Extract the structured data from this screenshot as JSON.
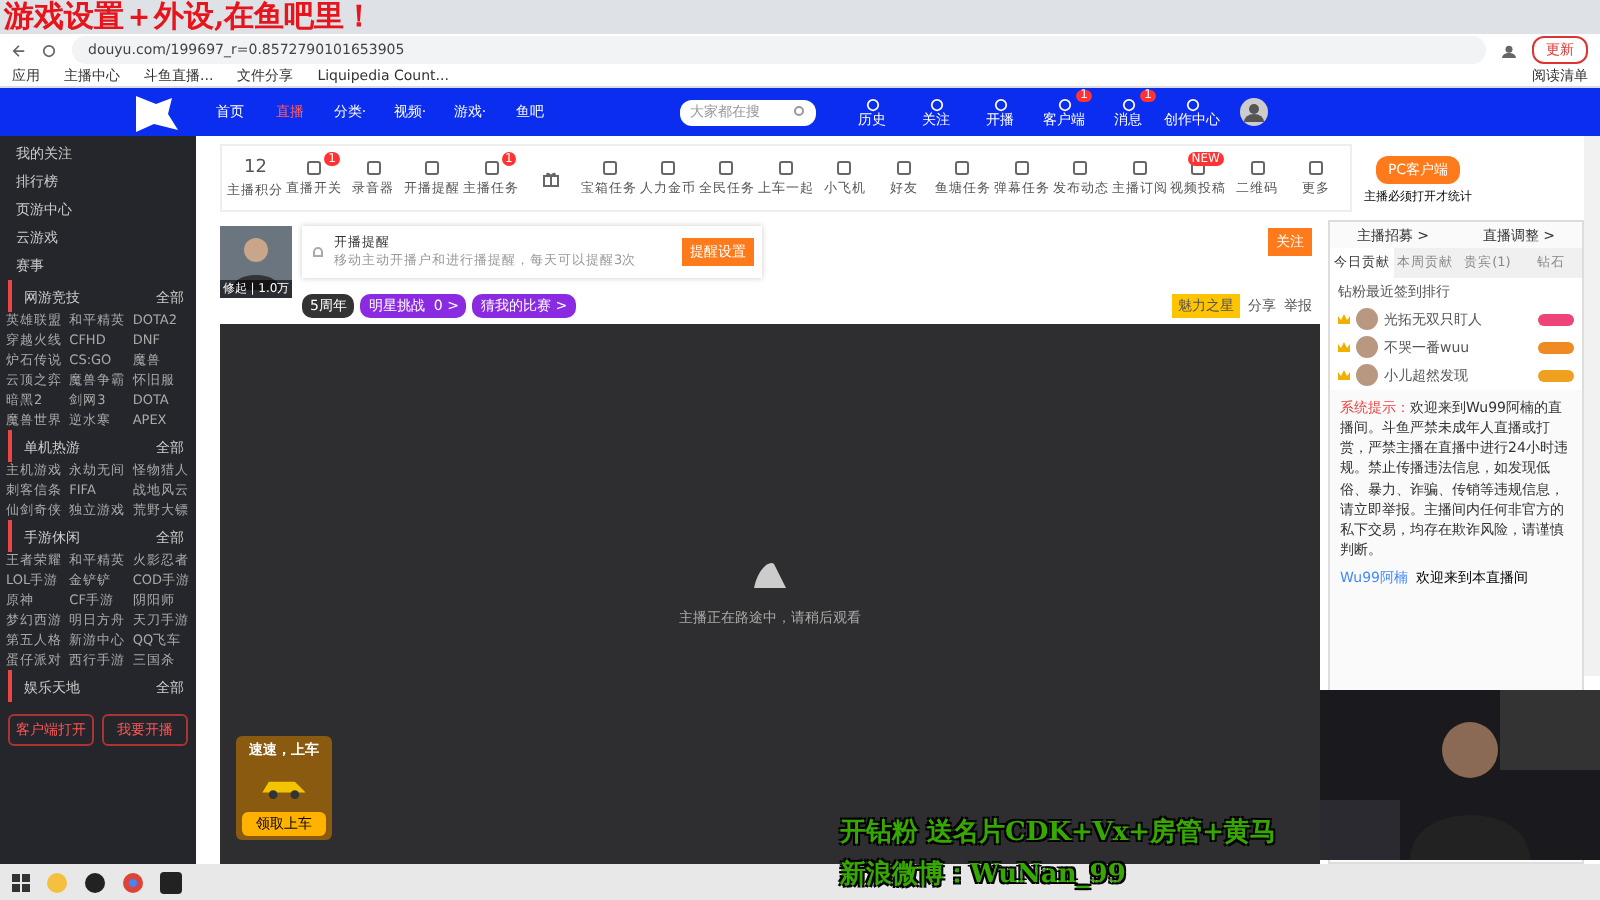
{
  "overlay_title": "游戏设置＋外设,在鱼吧里！",
  "browser": {
    "url": "douyu.com/199697_r=0.8572790101653905",
    "bookmarks": [
      "应用",
      "主播中心",
      "斗鱼直播...",
      "文件分享",
      "Liquipedia Count..."
    ],
    "reading_list": "阅读清单",
    "profile_button": "更新"
  },
  "header": {
    "nav": [
      {
        "label": "首页",
        "selected": false
      },
      {
        "label": "直播",
        "selected": true
      },
      {
        "label": "分类·",
        "selected": false
      },
      {
        "label": "视频·",
        "selected": false
      },
      {
        "label": "游戏·",
        "selected": false
      },
      {
        "label": "鱼吧",
        "selected": false
      }
    ],
    "search": {
      "placeholder": "大家都在搜"
    },
    "actions": [
      {
        "label": "历史"
      },
      {
        "label": "关注"
      },
      {
        "label": "开播"
      },
      {
        "label": "客户端",
        "badge": "1"
      },
      {
        "label": "消息",
        "badge": "1"
      },
      {
        "label": "创作中心"
      }
    ]
  },
  "sidebar": {
    "links": [
      "我的关注",
      "排行榜",
      "页游中心",
      "云游戏",
      "赛事"
    ],
    "sections": [
      {
        "title": "网游竞技",
        "more": "全部",
        "games": [
          "英雄联盟",
          "和平精英",
          "DOTA2",
          "穿越火线",
          "CFHD",
          "DNF",
          "炉石传说",
          "CS:GO",
          "魔兽",
          "云顶之弈",
          "魔兽争霸",
          "怀旧服",
          "暗黑2",
          "剑网3",
          "DOTA",
          "魔兽世界",
          "逆水寒",
          "APEX"
        ]
      },
      {
        "title": "单机热游",
        "more": "全部",
        "games": [
          "主机游戏",
          "永劫无间",
          "怪物猎人",
          "刺客信条",
          "FIFA",
          "战地风云",
          "仙剑奇侠",
          "独立游戏",
          "荒野大镖"
        ]
      },
      {
        "title": "手游休闲",
        "more": "全部",
        "games": [
          "王者荣耀",
          "和平精英",
          "火影忍者",
          "LOL手游",
          "金铲铲",
          "COD手游",
          "原神",
          "CF手游",
          "阴阳师",
          "梦幻西游",
          "明日方舟",
          "天刀手游",
          "第五人格",
          "新游中心",
          "QQ飞车",
          "蛋仔派对",
          "西行手游",
          "三国杀"
        ]
      },
      {
        "title": "娱乐天地",
        "more": "全部"
      }
    ],
    "buttons": [
      "客户端打开",
      "我要开播"
    ]
  },
  "toolbar": {
    "score": "12",
    "score_label": "主播积分",
    "items": [
      {
        "label": "直播开关",
        "badge": "1"
      },
      {
        "label": "录音器"
      },
      {
        "label": "开播提醒"
      },
      {
        "label": "主播任务",
        "badge": "1"
      },
      {
        "kind": "gift"
      },
      {
        "label": "宝箱任务"
      },
      {
        "label": "人力金币"
      },
      {
        "label": "全民任务"
      },
      {
        "label": "上车一起"
      },
      {
        "label": "小飞机"
      },
      {
        "label": "好友"
      },
      {
        "label": "鱼塘任务"
      },
      {
        "label": "弹幕任务"
      },
      {
        "label": "发布动态"
      },
      {
        "label": "主播订阅"
      },
      {
        "label": "视频投稿",
        "badge": "NEW"
      },
      {
        "label": "二维码"
      },
      {
        "label": "更多"
      }
    ],
    "pc_button": "PC客户端",
    "pc_note": "主播必须打开才统计"
  },
  "streamer": {
    "avatar_caption": "修起 | 1.0万",
    "reminder_title": "开播提醒",
    "reminder_text": "移动主动开播户和进行播提醒，每天可以提醒3次",
    "reminder_button": "提醒设置",
    "tags": [
      "5周年",
      "明星挑战  0 >",
      "猜我的比赛 >"
    ],
    "rank_button": "魅力之星",
    "share": "分享",
    "report": "举报",
    "follow_button": "关注"
  },
  "video": {
    "message": "主播正在路途中，请稍后观看",
    "ad_title": "速速，上车",
    "ad_button": "领取上车"
  },
  "chat": {
    "header": [
      "主播招募 >",
      "直播调整 >"
    ],
    "tabs": [
      {
        "label": "今日贡献",
        "selected": true
      },
      {
        "label": "本周贡献",
        "selected": false
      },
      {
        "label": "贵宾(1)",
        "selected": false
      },
      {
        "label": "钻石",
        "selected": false
      }
    ],
    "fans_title": "钻粉最近签到排行",
    "fans": [
      {
        "name": "光拓无双只盯人",
        "color": "#ee4477"
      },
      {
        "name": "不哭一番wuu",
        "color": "#f08a24"
      },
      {
        "name": "小儿超然发现",
        "color": "#f0a020"
      }
    ],
    "notice_label": "系统提示：",
    "notice": "欢迎来到Wu99阿楠的直播间。斗鱼严禁未成年人直播或打赏，严禁主播在直播中进行24小时违规。禁止传播违法信息，如发现低俗、暴力、诈骗、传销等违规信息，请立即举报。主播间内任何非官方的私下交易，均存在欺诈风险，请谨慎判断。",
    "welcome_user": "Wu99阿楠",
    "welcome": "欢迎来到本直播间"
  },
  "bottom_overlay": [
    "开钻粉 送名片CDK+Vx+房管+黄马",
    "新浪微博：WuNan_99"
  ]
}
